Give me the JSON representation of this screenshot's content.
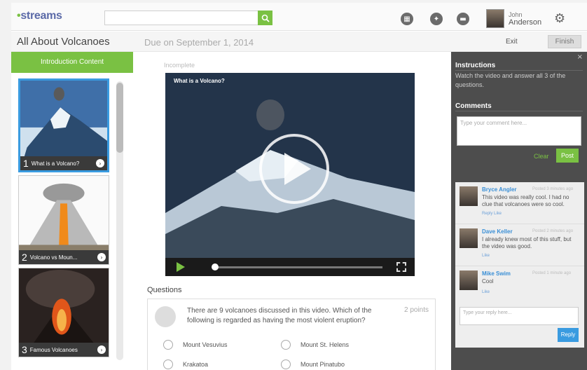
{
  "app": {
    "logo": "streams"
  },
  "header": {
    "search_placeholder": "",
    "user": {
      "first": "John",
      "last": "Anderson"
    }
  },
  "assignment": {
    "title": "All About Volcanoes",
    "due": "Due on September 1, 2014",
    "exit_label": "Exit",
    "finish_label": "Finish"
  },
  "sidebar": {
    "tab_label": "Introduction Content",
    "items": [
      {
        "num": "1",
        "label": "What is a Volcano?"
      },
      {
        "num": "2",
        "label": "Volcano vs Moun..."
      },
      {
        "num": "3",
        "label": "Famous Volcanoes"
      }
    ]
  },
  "video": {
    "status": "Incomplete",
    "title": "What is a Volcano?",
    "progress": 0
  },
  "questions": {
    "label": "Questions",
    "q1": {
      "text": "There are 9 volcanoes discussed in this video.  Which of the following is regarded as having the most violent eruption?",
      "points": "2 points",
      "options": [
        "Mount Vesuvius",
        "Mount St. Helens",
        "Krakatoa",
        "Mount Pinatubo"
      ]
    }
  },
  "right_panel": {
    "instructions_heading": "Instructions",
    "instructions_text": "Watch the video and answer all 3 of the questions.",
    "comments_heading": "Comments",
    "comment_placeholder": "Type your comment here...",
    "clear_label": "Clear",
    "post_label": "Post",
    "reply_placeholder": "Type your reply here...",
    "reply_label": "Reply",
    "comments": [
      {
        "name": "Bryce Angler",
        "time": "Posted 3 minutes ago",
        "text": "This video was really cool. I had no clue that volcanoes were so cool.",
        "actions": "Reply  Like"
      },
      {
        "name": "Dave Keller",
        "time": "Posted 2 minutes ago",
        "text": "I already knew most of this stuff, but the video was good.",
        "actions": "Like"
      },
      {
        "name": "Mike Swim",
        "time": "Posted 1 minute ago",
        "text": "Cool",
        "actions": "Like"
      }
    ]
  },
  "colors": {
    "accent": "#7ac143",
    "link": "#3a9be0",
    "panel": "#4d4d4d"
  }
}
